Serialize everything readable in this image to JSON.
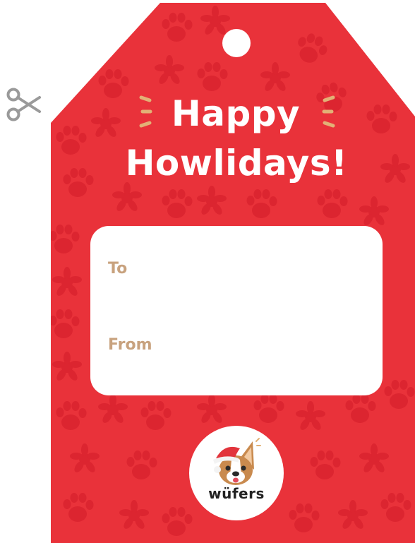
{
  "tag": {
    "title_line1": "Happy",
    "title_line2": "Howlidays!",
    "to_label": "To",
    "from_label": "From"
  },
  "brand": {
    "name": "wüfers"
  },
  "colors": {
    "tag_red": "#e9323a",
    "paw_red": "#dc2530",
    "label_tan": "#c8a27e",
    "sparkle_gold": "#e2b176",
    "scissors_gray": "#9a9a9a"
  },
  "icons": [
    "scissors-icon",
    "sparkle-icon",
    "paw-print-pattern",
    "dog-santa-logo"
  ]
}
